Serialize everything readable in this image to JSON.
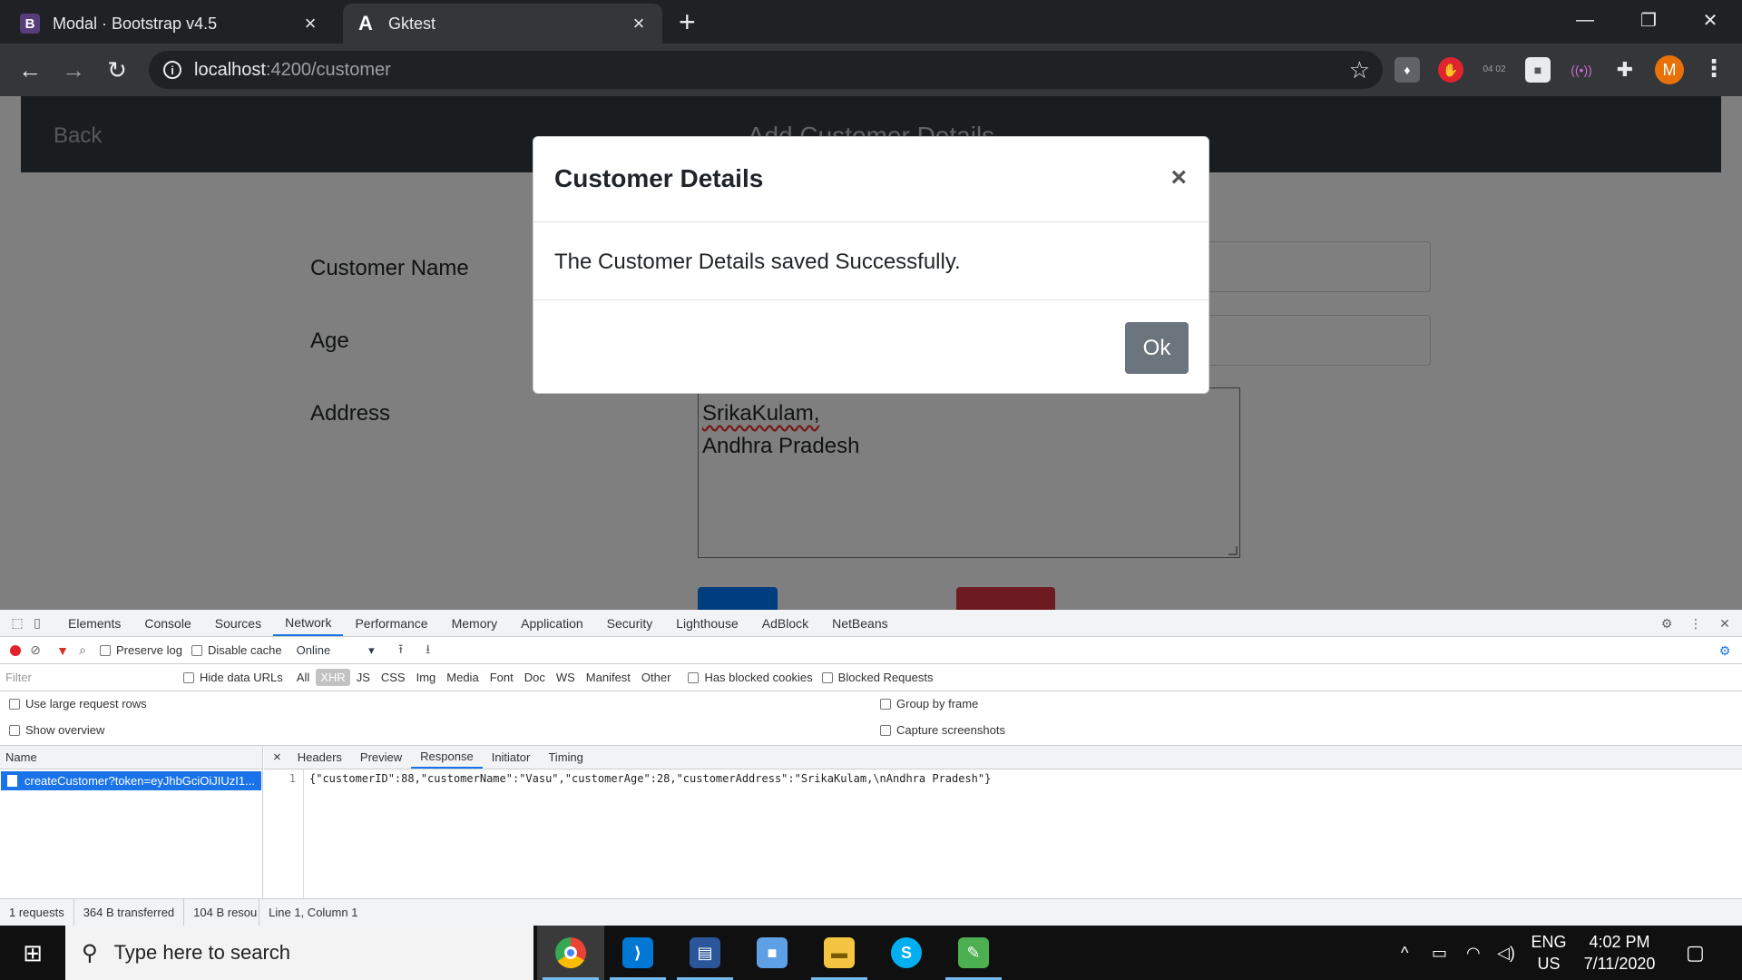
{
  "browser": {
    "tabs": [
      {
        "label": "Modal · Bootstrap v4.5",
        "favicon": "B"
      },
      {
        "label": "Gktest",
        "favicon": "A"
      }
    ],
    "url_host": "localhost",
    "url_path": ":4200/customer",
    "profile_initial": "M",
    "ext_badge": "04 02"
  },
  "page": {
    "back_label": "Back",
    "title": "Add Customer Details",
    "form": {
      "name_label": "Customer Name",
      "age_label": "Age",
      "address_label": "Address",
      "address_line1": "SrikaKulam,",
      "address_line2": "Andhra Pradesh"
    }
  },
  "modal": {
    "title": "Customer Details",
    "close": "×",
    "message": "The Customer Details saved Successfully.",
    "ok_label": "Ok"
  },
  "devtools": {
    "tabs": [
      "Elements",
      "Console",
      "Sources",
      "Network",
      "Performance",
      "Memory",
      "Application",
      "Security",
      "Lighthouse",
      "AdBlock",
      "NetBeans"
    ],
    "selected_tab": "Network",
    "preserve_log": "Preserve log",
    "disable_cache": "Disable cache",
    "throttle": "Online",
    "filter_placeholder": "Filter",
    "hide_data_urls": "Hide data URLs",
    "types": [
      "All",
      "XHR",
      "JS",
      "CSS",
      "Img",
      "Media",
      "Font",
      "Doc",
      "WS",
      "Manifest",
      "Other"
    ],
    "selected_type": "XHR",
    "has_blocked_cookies": "Has blocked cookies",
    "blocked_requests": "Blocked Requests",
    "large_rows": "Use large request rows",
    "show_overview": "Show overview",
    "group_by_frame": "Group by frame",
    "capture_screenshots": "Capture screenshots",
    "name_header": "Name",
    "request_name": "createCustomer?token=eyJhbGciOiJIUzI1...",
    "sub_tabs": [
      "Headers",
      "Preview",
      "Response",
      "Initiator",
      "Timing"
    ],
    "selected_sub_tab": "Response",
    "line_number": "1",
    "response_text": "{\"customerID\":88,\"customerName\":\"Vasu\",\"customerAge\":28,\"customerAddress\":\"SrikaKulam,\\nAndhra Pradesh\"}",
    "status": {
      "requests": "1 requests",
      "transferred": "364 B transferred",
      "resources": "104 B resou",
      "position": "Line 1, Column 1"
    }
  },
  "taskbar": {
    "search_placeholder": "Type here to search",
    "lang_line1": "ENG",
    "lang_line2": "US",
    "time": "4:02 PM",
    "date": "7/11/2020"
  },
  "colors": {
    "navbar": "#343a40",
    "primary": "#007bff",
    "danger": "#dc3545",
    "secondary": "#6c757d",
    "devtools_accent": "#1a73e8"
  }
}
